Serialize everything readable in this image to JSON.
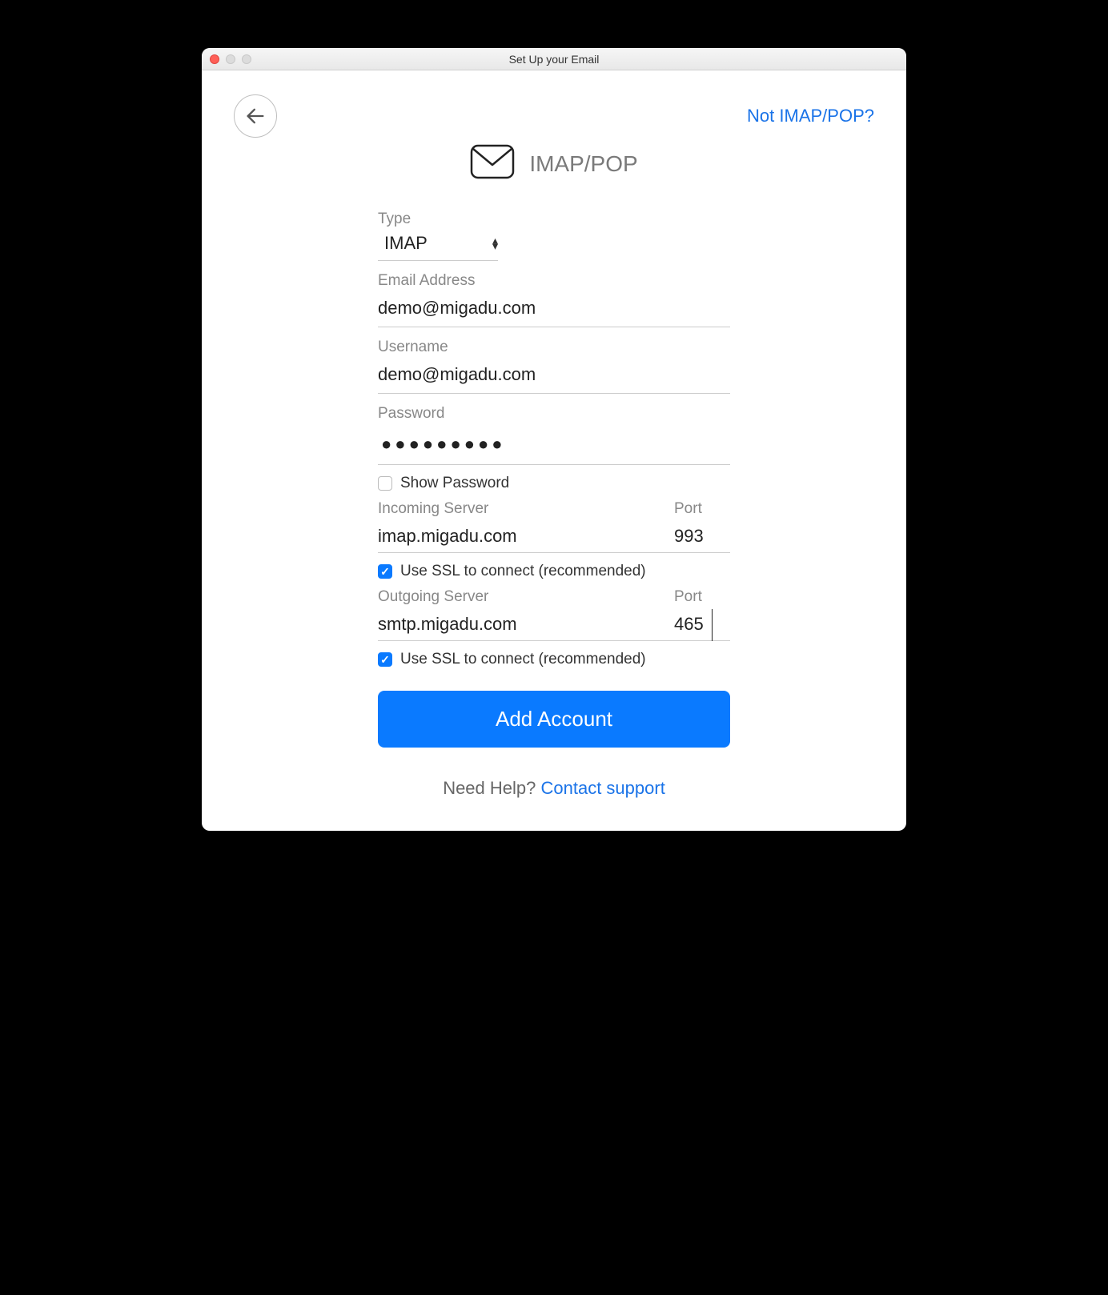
{
  "titlebar": {
    "title": "Set Up your Email"
  },
  "top": {
    "not_imap": "Not IMAP/POP?"
  },
  "header": {
    "protocol_label": "IMAP/POP"
  },
  "form": {
    "type_label": "Type",
    "type_value": "IMAP",
    "email_label": "Email Address",
    "email_value": "demo@migadu.com",
    "username_label": "Username",
    "username_value": "demo@migadu.com",
    "password_label": "Password",
    "password_masked": "●●●●●●●●●",
    "show_password_label": "Show Password",
    "show_password_checked": false,
    "incoming_label": "Incoming Server",
    "incoming_value": "imap.migadu.com",
    "incoming_port_label": "Port",
    "incoming_port_value": "993",
    "incoming_ssl_label": "Use SSL to connect (recommended)",
    "incoming_ssl_checked": true,
    "outgoing_label": "Outgoing Server",
    "outgoing_value": "smtp.migadu.com",
    "outgoing_port_label": "Port",
    "outgoing_port_value": "465",
    "outgoing_ssl_label": "Use SSL to connect (recommended)",
    "outgoing_ssl_checked": true,
    "add_button": "Add Account"
  },
  "footer": {
    "help_text": "Need Help? ",
    "contact_link": "Contact support"
  }
}
